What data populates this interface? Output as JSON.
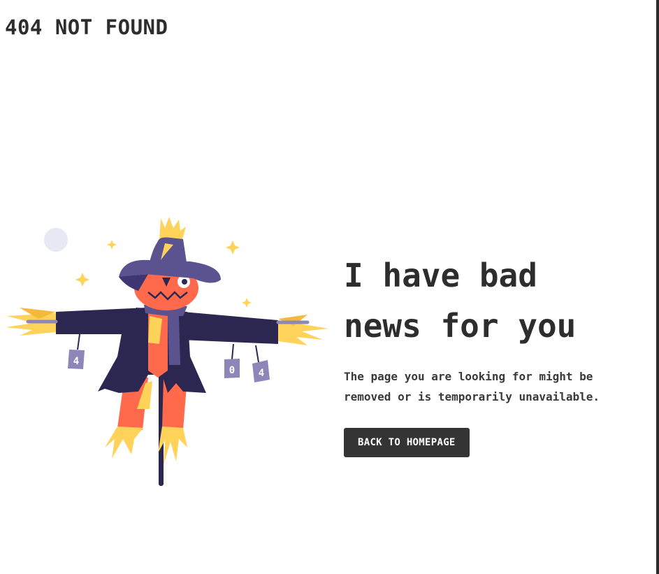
{
  "header": {
    "brand": "404 NOT FOUND"
  },
  "main": {
    "headline": "I have bad\nnews for you",
    "message": "The page you are looking for might be\nremoved or is temporarily unavailable.",
    "button_label": "BACK TO HOMEPAGE"
  },
  "illustration": {
    "cans": [
      "4",
      "0",
      "4"
    ],
    "colors": {
      "dark": "#2b2750",
      "purple": "#5b5290",
      "orange": "#ff6a4d",
      "yellow": "#ffd25a"
    }
  }
}
